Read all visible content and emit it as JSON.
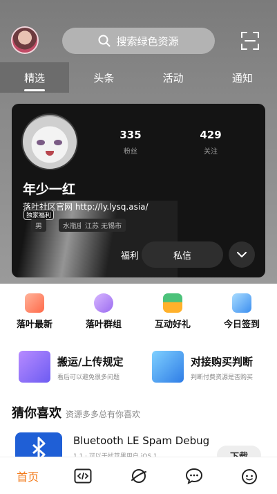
{
  "header": {
    "search_placeholder": "搜索绿色资源"
  },
  "tabs": [
    "精选",
    "头条",
    "活动",
    "通知"
  ],
  "profile": {
    "stats": [
      {
        "num": "335",
        "label": "粉丝"
      },
      {
        "num": "429",
        "label": "关注"
      }
    ],
    "name": "年少一红",
    "site": "落叶社区官网 http://ly.lysq.asia/",
    "badge": "独家福利",
    "chips": [
      "男",
      "水瓶座",
      "江苏 无锡市"
    ],
    "left_button": "福利",
    "message_button": "私信"
  },
  "quick": [
    "落叶最新",
    "落叶群组",
    "互动好礼",
    "今日签到"
  ],
  "promos": [
    {
      "title": "搬运/上传规定",
      "sub": "看后可以避免很多问题"
    },
    {
      "title": "对接购买判断",
      "sub": "判断付费资源是否购买"
    }
  ],
  "section": {
    "title": "猜你喜欢",
    "subtitle": "资源多多总有你喜欢"
  },
  "app": {
    "title": "Bluetooth LE Spam Debug",
    "sub": "1.1 · 可以干扰苹果用户 iOS 1...",
    "download": "下载"
  },
  "nav": {
    "home": "首页"
  },
  "colors": {
    "accent": "#f27a1a",
    "card_bg": "#141414"
  }
}
